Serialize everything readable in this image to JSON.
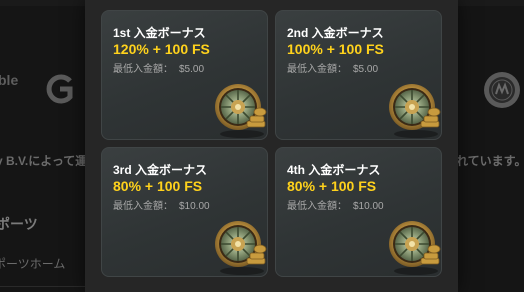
{
  "background": {
    "logo_text": "ble",
    "company_text": "y B.V.によって運",
    "right_text": "れています。",
    "sports_title": "ポーツ",
    "sports_home": "ポーツホーム"
  },
  "modal": {
    "cards": [
      {
        "title": "1st 入金ボーナス",
        "offer": "120% + 100 FS",
        "min_label": "最低入金額：",
        "min_value": "$5.00"
      },
      {
        "title": "2nd 入金ボーナス",
        "offer": "100% + 100 FS",
        "min_label": "最低入金額：",
        "min_value": "$5.00"
      },
      {
        "title": "3rd 入金ボーナス",
        "offer": "80% + 100 FS",
        "min_label": "最低入金額：",
        "min_value": "$10.00"
      },
      {
        "title": "4th 入金ボーナス",
        "offer": "80% + 100 FS",
        "min_label": "最低入金額：",
        "min_value": "$10.00"
      }
    ]
  },
  "colors": {
    "accent_yellow": "#ffd21c",
    "card_bg": "#32383a",
    "modal_bg": "#262626",
    "page_bg": "#151515"
  },
  "icons": [
    "roulette-wheel-icon",
    "gambling-logo-g-icon",
    "seal-badge-icon"
  ]
}
